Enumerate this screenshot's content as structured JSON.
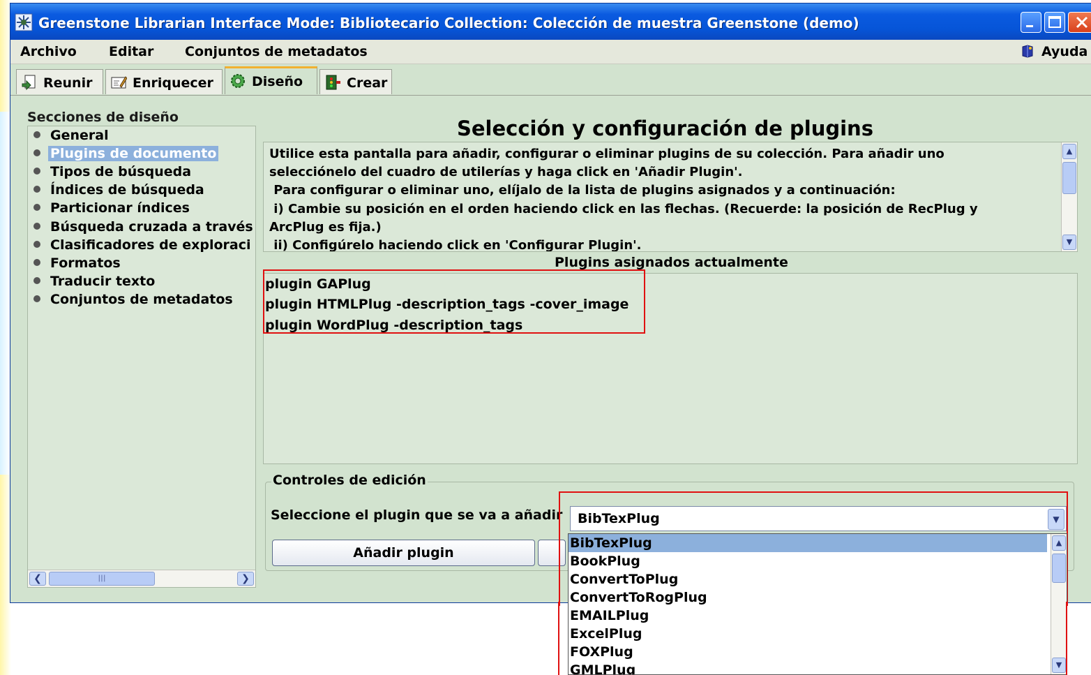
{
  "window": {
    "title": "Greenstone Librarian Interface  Mode: Bibliotecario  Collection: Colección de muestra Greenstone (demo)"
  },
  "menu": {
    "items": [
      "Archivo",
      "Editar",
      "Conjuntos de metadatos"
    ],
    "help": "Ayuda"
  },
  "tabs": [
    {
      "label": "Reunir",
      "icon": "gather-icon"
    },
    {
      "label": "Enriquecer",
      "icon": "enrich-icon"
    },
    {
      "label": "Diseño",
      "icon": "gear-icon",
      "active": true
    },
    {
      "label": "Crear",
      "icon": "create-icon"
    }
  ],
  "sidebar": {
    "heading": "Secciones de diseño",
    "items": [
      {
        "label": "General"
      },
      {
        "label": "Plugins de documento",
        "selected": true
      },
      {
        "label": "Tipos de búsqueda"
      },
      {
        "label": "Índices de búsqueda"
      },
      {
        "label": "Particionar índices"
      },
      {
        "label": "Búsqueda cruzada a través"
      },
      {
        "label": "Clasificadores de exploraci"
      },
      {
        "label": "Formatos"
      },
      {
        "label": "Traducir texto"
      },
      {
        "label": "Conjuntos de metadatos"
      }
    ]
  },
  "main": {
    "title": "Selección y configuración de plugins",
    "description": "Utilice esta pantalla para añadir, configurar o eliminar plugins de su colección. Para añadir uno\nselecciónelo del cuadro de utilerías y haga click en 'Añadir Plugin'.\n Para configurar o eliminar uno, elíjalo de la lista de plugins asignados y a continuación:\n i) Cambie su posición en el orden haciendo click en las flechas. (Recuerde: la posición de RecPlug y\nArcPlug es fija.)\n ii) Configúrelo haciendo click en 'Configurar Plugin'.",
    "assigned_label": "Plugins asignados actualmente",
    "assigned_plugins": [
      "plugin GAPlug",
      "plugin HTMLPlug -description_tags -cover_image",
      "plugin WordPlug -description_tags"
    ]
  },
  "edit_controls": {
    "legend": "Controles de edición",
    "select_label": "Seleccione el plugin que se va a añadir",
    "selected_value": "BibTexPlug",
    "add_button": "Añadir plugin",
    "options": [
      "BibTexPlug",
      "BookPlug",
      "ConvertToPlug",
      "ConvertToRogPlug",
      "EMAILPlug",
      "ExcelPlug",
      "FOXPlug",
      "GMLPlug"
    ],
    "highlighted_option": "BibTexPlug"
  },
  "colors": {
    "titlebar": "#0655d8",
    "panel_bg": "#d2e3cf",
    "selection": "#8cb0dc",
    "annotation_red": "#e01010"
  }
}
